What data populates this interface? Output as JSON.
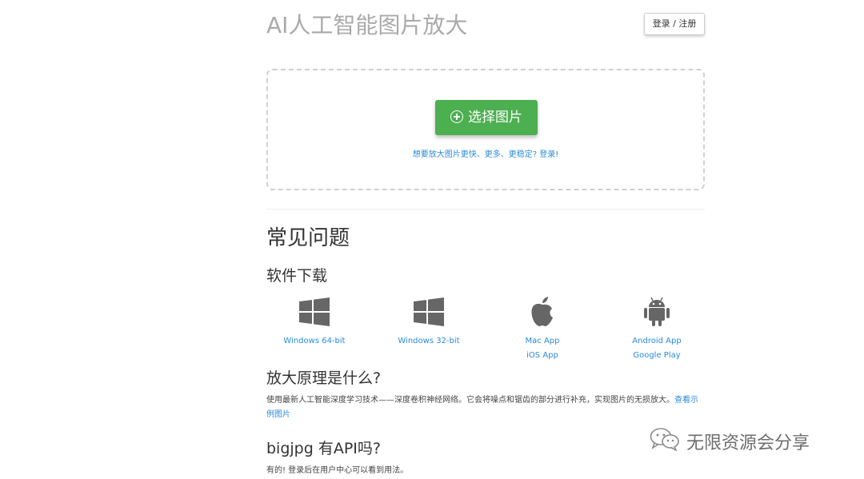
{
  "header": {
    "site_title": "AI人工智能图片放大",
    "login_label": "登录 / 注册"
  },
  "upload": {
    "select_label": "选择图片",
    "hint": "想要放大图片更快、更多、更稳定? 登录!"
  },
  "faq": {
    "title": "常见问题",
    "download_title": "软件下载",
    "downloads": [
      {
        "icon": "windows-icon",
        "links": [
          "Windows 64-bit"
        ]
      },
      {
        "icon": "windows-icon",
        "links": [
          "Windows 32-bit"
        ]
      },
      {
        "icon": "apple-icon",
        "links": [
          "Mac App",
          "iOS App"
        ]
      },
      {
        "icon": "android-icon",
        "links": [
          "Android App",
          "Google Play"
        ]
      }
    ],
    "q1": {
      "title": "放大原理是什么?",
      "text": "使用最新人工智能深度学习技术——深度卷积神经网络。它会将噪点和锯齿的部分进行补充，实现图片的无损放大。",
      "link": "查看示例图片"
    },
    "q2": {
      "title": "bigjpg 有API吗?",
      "text": "有的! 登录后在用户中心可以看到用法。"
    }
  },
  "watermark": {
    "text": "无限资源会分享"
  },
  "colors": {
    "primary_green": "#4caf50",
    "link_blue": "#2a8bd8",
    "title_gray": "#aaaaaa"
  }
}
